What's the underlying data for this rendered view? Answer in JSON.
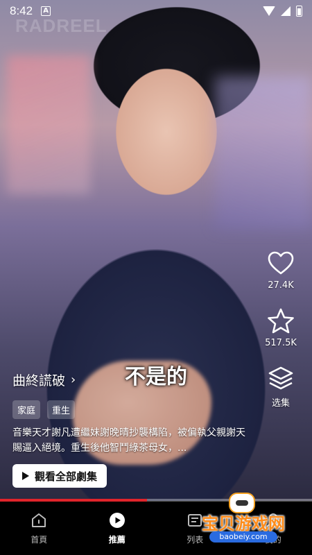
{
  "status_bar": {
    "time": "8:42",
    "notification_letter": "A"
  },
  "video": {
    "watermark": "RADREEL",
    "subtitle": "不是的",
    "progress_percent": 47
  },
  "actions": {
    "like": {
      "icon": "heart-icon",
      "count": "27.4K"
    },
    "favorite": {
      "icon": "star-icon",
      "count": "517.5K"
    },
    "episodes": {
      "icon": "layers-icon",
      "label": "选集"
    }
  },
  "drama": {
    "title": "曲終謊破",
    "tags": [
      "家庭",
      "重生"
    ],
    "description": "音樂天才謝凡遭繼妹謝晚晴抄襲構陷，被偏執父親謝天賜逼入絕境。重生後他智鬥綠茶母女，...",
    "watch_all_label": "觀看全部劇集"
  },
  "bottom_nav": {
    "items": [
      {
        "label": "首頁",
        "icon": "home-icon",
        "active": false
      },
      {
        "label": "推薦",
        "icon": "play-circle-icon",
        "active": true
      },
      {
        "label": "列表",
        "icon": "list-icon",
        "active": false
      },
      {
        "label": "我的",
        "icon": "profile-icon",
        "active": false
      }
    ]
  },
  "site_watermark": {
    "brand": "宝贝游戏网",
    "url": "baobeiy.com"
  },
  "colors": {
    "accent": "#e0242b",
    "brand_orange": "#ff8c1a",
    "nav_bg": "#000000"
  }
}
